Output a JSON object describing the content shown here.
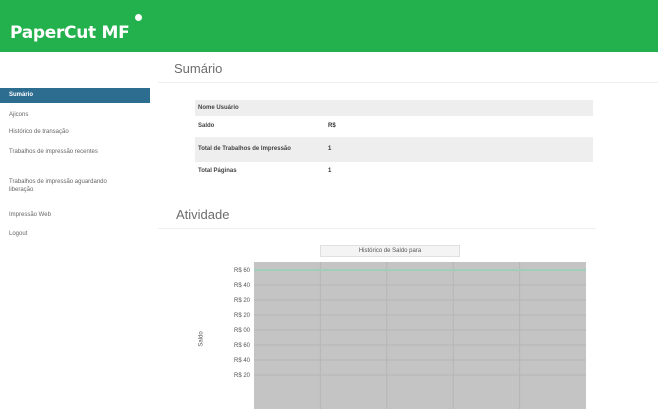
{
  "header": {
    "brand": "PaperCut MF",
    "brand_color": "#22b14c"
  },
  "sidebar": {
    "items": [
      {
        "label": "Sumário",
        "active": true
      },
      {
        "label": "Ajicons",
        "active": false
      },
      {
        "label": "Histórico de transação",
        "active": false
      },
      {
        "label": "Trabalhos de impressão recentes",
        "active": false
      },
      {
        "label": "Trabalhos de impressão aguardando liberação",
        "active": false
      },
      {
        "label": "Impressão Web",
        "active": false
      },
      {
        "label": "Logout",
        "active": false
      }
    ]
  },
  "page": {
    "title": "Sumário"
  },
  "summary": {
    "rows": [
      {
        "label": "Nome Usuário",
        "value": ""
      },
      {
        "label": "Saldo",
        "value": "R$"
      },
      {
        "label": "Total de Trabalhos de Impressão",
        "value": "1"
      },
      {
        "label": "Total Páginas",
        "value": "1"
      }
    ]
  },
  "activity": {
    "title": "Atividade"
  },
  "chart_data": {
    "type": "line",
    "title": "Histórico de Saldo para",
    "ylabel": "Saldo",
    "y_ticks": [
      "R$ 60",
      "R$ 40",
      "R$ 20",
      "R$ 20",
      "R$ 00",
      "R$ 60",
      "R$ 40",
      "R$ 20"
    ],
    "series": [
      {
        "values": [
          1,
          1,
          1,
          1,
          1,
          1
        ]
      }
    ],
    "ylim": [
      0,
      1
    ],
    "grid": true,
    "plot_bg": "#c4c4c4",
    "line_color": "#9fcfb7"
  }
}
